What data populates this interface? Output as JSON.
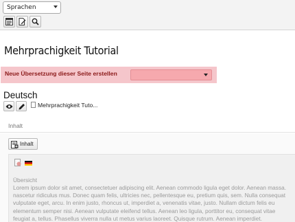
{
  "toolbar": {
    "language_select": {
      "selected": "Sprachen"
    },
    "buttons": [
      {
        "icon": "page-properties-icon"
      },
      {
        "icon": "edit-page-icon"
      },
      {
        "icon": "search-icon"
      }
    ]
  },
  "page": {
    "title": "Mehrprachigkeit Tutorial"
  },
  "new_translation": {
    "label": "Neue Übersetzung dieser Seite erstellen",
    "select_value": "",
    "highlight_color": "#f5c6cb"
  },
  "language_section": {
    "heading": "Deutsch",
    "page_link": "Mehrprachigkeit Tuto..."
  },
  "content_section": {
    "header": "Inhalt",
    "add_button_label": "Inhalt",
    "element": {
      "header": "Übersicht",
      "body_lines": [
        "Lorem ipsum dolor sit amet, consectetuer adipiscing elit. Aenean commodo ligula eget dolor. Aenean massa.",
        "nascetur ridiculus mus. Donec quam felis, ultricies nec, pellentesque eu, pretium quis, sem. Nulla consequat",
        "vulputate eget, arcu. In enim justo, rhoncus ut, imperdiet a, venenatis vitae, justo. Nullam dictum felis eu",
        "elementum semper nisi. Aenean vulputate eleifend tellus. Aenean leo ligula, porttitor eu, consequat vitae",
        "feugiat a, tellus. Phasellus viverra nulla ut metus varius laoreet. Quisque rutrum. Aenean imperdiet."
      ]
    }
  }
}
